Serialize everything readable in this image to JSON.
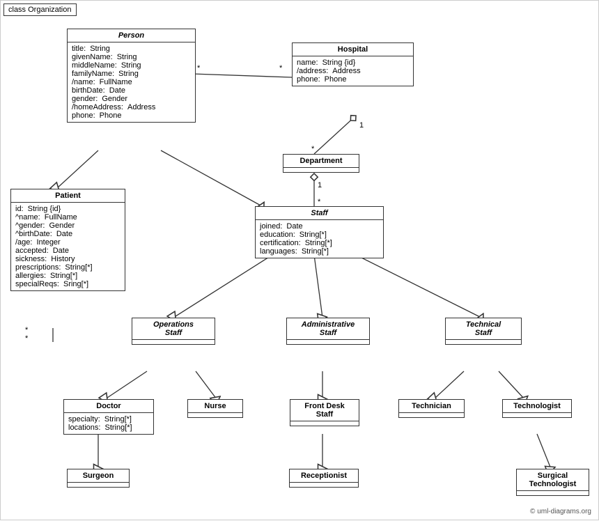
{
  "title": "class Organization",
  "copyright": "© uml-diagrams.org",
  "classes": {
    "person": {
      "name": "Person",
      "italic": true,
      "attrs": [
        {
          "name": "title:",
          "type": "String"
        },
        {
          "name": "givenName:",
          "type": "String"
        },
        {
          "name": "middleName:",
          "type": "String"
        },
        {
          "name": "familyName:",
          "type": "String"
        },
        {
          "name": "/name:",
          "type": "FullName"
        },
        {
          "name": "birthDate:",
          "type": "Date"
        },
        {
          "name": "gender:",
          "type": "Gender"
        },
        {
          "name": "/homeAddress:",
          "type": "Address"
        },
        {
          "name": "phone:",
          "type": "Phone"
        }
      ]
    },
    "hospital": {
      "name": "Hospital",
      "italic": false,
      "attrs": [
        {
          "name": "name:",
          "type": "String {id}"
        },
        {
          "name": "/address:",
          "type": "Address"
        },
        {
          "name": "phone:",
          "type": "Phone"
        }
      ]
    },
    "department": {
      "name": "Department",
      "italic": false,
      "attrs": []
    },
    "staff": {
      "name": "Staff",
      "italic": true,
      "attrs": [
        {
          "name": "joined:",
          "type": "Date"
        },
        {
          "name": "education:",
          "type": "String[*]"
        },
        {
          "name": "certification:",
          "type": "String[*]"
        },
        {
          "name": "languages:",
          "type": "String[*]"
        }
      ]
    },
    "patient": {
      "name": "Patient",
      "italic": false,
      "attrs": [
        {
          "name": "id:",
          "type": "String {id}"
        },
        {
          "name": "^name:",
          "type": "FullName"
        },
        {
          "name": "^gender:",
          "type": "Gender"
        },
        {
          "name": "^birthDate:",
          "type": "Date"
        },
        {
          "name": "/age:",
          "type": "Integer"
        },
        {
          "name": "accepted:",
          "type": "Date"
        },
        {
          "name": "sickness:",
          "type": "History"
        },
        {
          "name": "prescriptions:",
          "type": "String[*]"
        },
        {
          "name": "allergies:",
          "type": "String[*]"
        },
        {
          "name": "specialReqs:",
          "type": "Sring[*]"
        }
      ]
    },
    "operationsStaff": {
      "name": "Operations\nStaff",
      "italic": true,
      "attrs": []
    },
    "administrativeStaff": {
      "name": "Administrative\nStaff",
      "italic": true,
      "attrs": []
    },
    "technicalStaff": {
      "name": "Technical\nStaff",
      "italic": true,
      "attrs": []
    },
    "doctor": {
      "name": "Doctor",
      "italic": false,
      "attrs": [
        {
          "name": "specialty:",
          "type": "String[*]"
        },
        {
          "name": "locations:",
          "type": "String[*]"
        }
      ]
    },
    "nurse": {
      "name": "Nurse",
      "italic": false,
      "attrs": []
    },
    "frontDeskStaff": {
      "name": "Front Desk\nStaff",
      "italic": false,
      "attrs": []
    },
    "technician": {
      "name": "Technician",
      "italic": false,
      "attrs": []
    },
    "technologist": {
      "name": "Technologist",
      "italic": false,
      "attrs": []
    },
    "surgeon": {
      "name": "Surgeon",
      "italic": false,
      "attrs": []
    },
    "receptionist": {
      "name": "Receptionist",
      "italic": false,
      "attrs": []
    },
    "surgicalTechnologist": {
      "name": "Surgical\nTechnologist",
      "italic": false,
      "attrs": []
    }
  }
}
